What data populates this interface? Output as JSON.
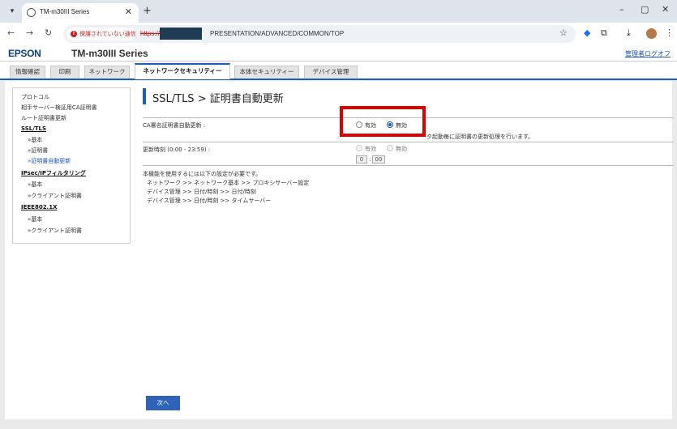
{
  "browser": {
    "tab_title": "TM-m30III Series",
    "tab_close": "✕",
    "new_tab": "+",
    "window_controls": [
      "–",
      "▢",
      "✕"
    ],
    "security_warning": "保護されていない通信",
    "url_scheme": "https://",
    "url_path": "PRESENTATION/ADVANCED/COMMON/TOP"
  },
  "header": {
    "brand": "EPSON",
    "model": "TM-m30III Series",
    "logout": "管理者ログオフ"
  },
  "tabs": [
    {
      "label": "情報確認"
    },
    {
      "label": "印刷"
    },
    {
      "label": "ネットワーク"
    },
    {
      "label": "ネットワークセキュリティー",
      "active": true
    },
    {
      "label": "本体セキュリティー"
    },
    {
      "label": "デバイス管理"
    }
  ],
  "sidebar": {
    "items": [
      "プロトコル",
      "相手サーバー検証用CA証明書",
      "ルート証明書更新"
    ],
    "ssl_head": "SSL/TLS",
    "ssl_items": [
      "»基本",
      "»証明書",
      "»証明書自動更新"
    ],
    "ipsec_head": "IPsec/IPフィルタリング",
    "ipsec_items": [
      "»基本",
      "»クライアント証明書"
    ],
    "ieee_head": "IEEE802.1X",
    "ieee_items": [
      "»基本",
      "»クライアント証明書"
    ]
  },
  "main": {
    "title": "SSL/TLS > 証明書自動更新",
    "ca_auto_update_label": "CA署名証明書自動更新 :",
    "enabled_label": "有効",
    "disabled_label": "無効",
    "ca_auto_update_selected": "無効",
    "ca_note": "夕起動毎に証明書の更新処理を行います。",
    "update_time_label": "更新時刻 (0:00 - 23:59) :",
    "time_hour": "0",
    "time_sep": ":",
    "time_minute": "00",
    "requirements_intro": "本機能を使用するには以下の設定が必要です。",
    "requirements": [
      "ネットワーク >> ネットワーク基本 >> プロキシサーバー設定",
      "デバイス管理 >> 日付/時刻 >> 日付/時刻",
      "デバイス管理 >> 日付/時刻 >> タイムサーバー"
    ],
    "next_button": "次へ"
  },
  "colors": {
    "accent": "#1c5fb6",
    "highlight": "#e00000",
    "warning": "#c5221f"
  }
}
